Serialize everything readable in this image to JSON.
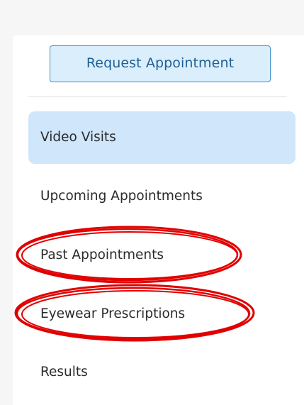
{
  "sidebar": {
    "request_button_label": "Request Appointment",
    "active_color": "#cfe6fb",
    "items": [
      {
        "label": "Video Visits",
        "active": true
      },
      {
        "label": "Upcoming Appointments",
        "active": false
      },
      {
        "label": "Past Appointments",
        "active": false,
        "highlighted": true
      },
      {
        "label": "Eyewear Prescriptions",
        "active": false,
        "highlighted": true
      },
      {
        "label": "Results",
        "active": false
      }
    ]
  },
  "annotation": {
    "style": "red-ellipse",
    "color": "#e00000"
  }
}
